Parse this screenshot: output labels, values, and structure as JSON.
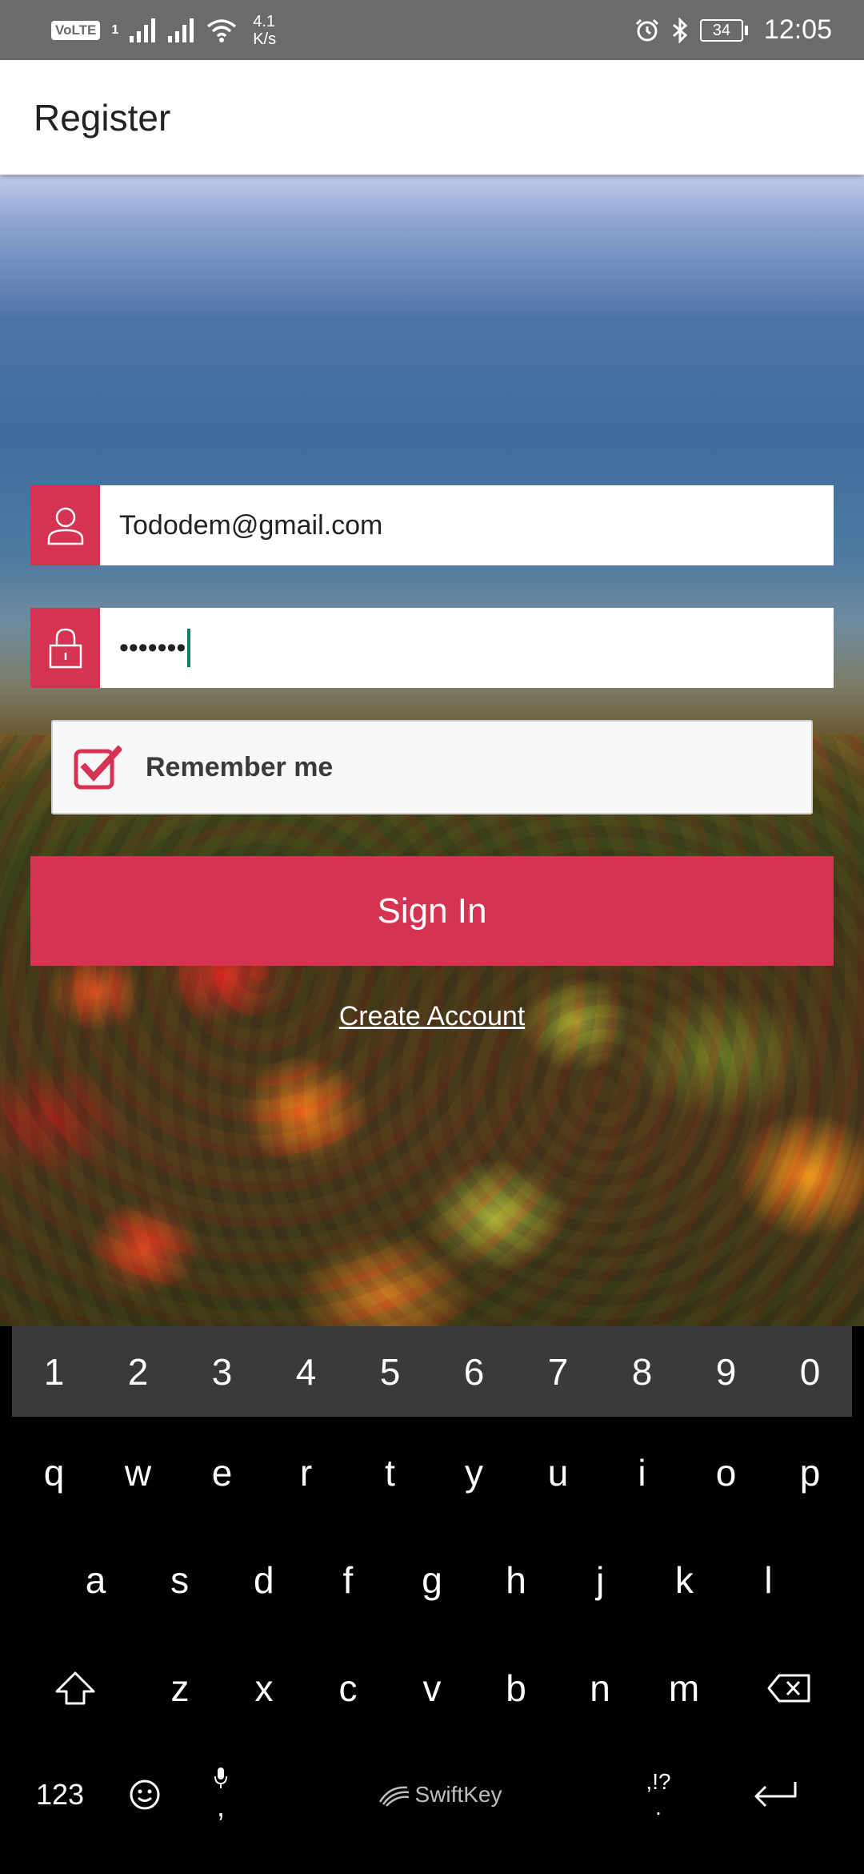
{
  "status_bar": {
    "volte": "VoLTE",
    "sim": "1",
    "netspeed_value": "4.1",
    "netspeed_unit": "K/s",
    "battery": "34",
    "time": "12:05"
  },
  "app_bar": {
    "title": "Register"
  },
  "form": {
    "email_value": "Tododem@gmail.com",
    "password_value": "•••••••",
    "remember_label": "Remember me",
    "remember_checked": true,
    "signin_label": "Sign In",
    "create_account_label": "Create Account"
  },
  "colors": {
    "accent": "#d63352",
    "caret": "#0f7f6e"
  },
  "keyboard": {
    "numbers": [
      "1",
      "2",
      "3",
      "4",
      "5",
      "6",
      "7",
      "8",
      "9",
      "0"
    ],
    "row1": [
      "q",
      "w",
      "e",
      "r",
      "t",
      "y",
      "u",
      "i",
      "o",
      "p"
    ],
    "row2": [
      "a",
      "s",
      "d",
      "f",
      "g",
      "h",
      "j",
      "k",
      "l"
    ],
    "row3": [
      "z",
      "x",
      "c",
      "v",
      "b",
      "n",
      "m"
    ],
    "symbols_key": "123",
    "comma_key": ",",
    "brand": "SwiftKey",
    "punct_hint": ",!?",
    "period_key": "."
  }
}
